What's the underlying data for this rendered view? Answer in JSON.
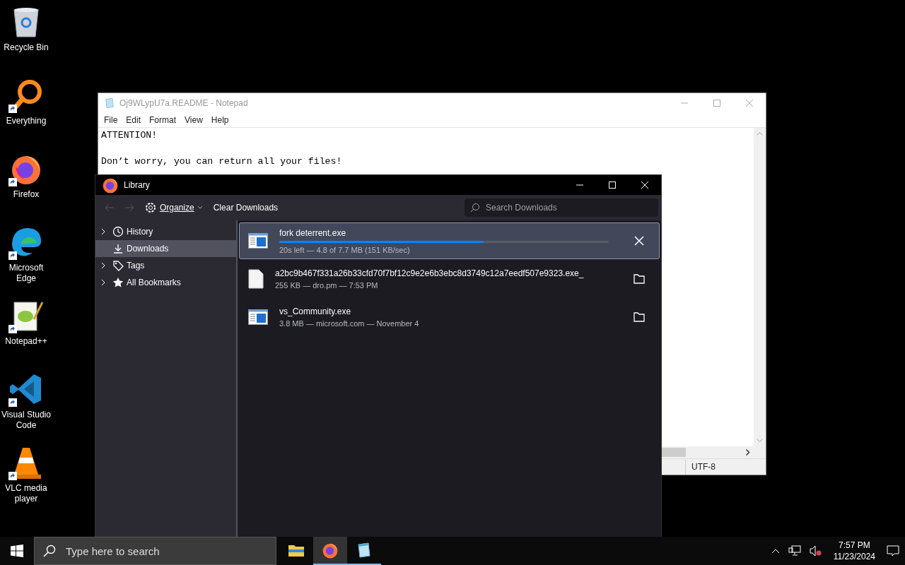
{
  "desktop_icons": [
    {
      "label": "Recycle Bin",
      "kind": "recycle",
      "shortcut": false
    },
    {
      "label": "Everything",
      "kind": "everything",
      "shortcut": true
    },
    {
      "label": "Firefox",
      "kind": "firefox",
      "shortcut": true
    },
    {
      "label": "Microsoft Edge",
      "kind": "edge",
      "shortcut": true
    },
    {
      "label": "Notepad++",
      "kind": "notepadpp",
      "shortcut": true
    },
    {
      "label": "Visual Studio Code",
      "kind": "vscode",
      "shortcut": true
    },
    {
      "label": "VLC media player",
      "kind": "vlc",
      "shortcut": true
    }
  ],
  "notepad": {
    "title": "Oj9WLypU7a.README - Notepad",
    "active": false,
    "menu": [
      "File",
      "Edit",
      "Format",
      "View",
      "Help"
    ],
    "lines": [
      {
        "text": "ATTENTION!",
        "blank_after": true
      },
      {
        "text": "Don’t worry, you can return all your files!",
        "blank_after": false
      }
    ],
    "encoding": "UTF-8"
  },
  "library": {
    "title": "Library",
    "active": true,
    "toolbar": {
      "organize": "Organize",
      "clear": "Clear Downloads",
      "search_placeholder": "Search Downloads"
    },
    "sidebar": [
      {
        "label": "History",
        "kind": "history",
        "expandable": true,
        "selected": false
      },
      {
        "label": "Downloads",
        "kind": "downloads",
        "expandable": false,
        "selected": true
      },
      {
        "label": "Tags",
        "kind": "tags",
        "expandable": true,
        "selected": false
      },
      {
        "label": "All Bookmarks",
        "kind": "bookmarks",
        "expandable": true,
        "selected": false
      }
    ],
    "downloads": [
      {
        "name": "fork deterrent.exe",
        "status": "20s left — 4.8 of 7.7 MB (151 KB/sec)",
        "kind": "exe",
        "level": 0.62,
        "selected": true
      },
      {
        "name": "a2bc9b467f331a26b33cfd70f7bf12c9e2e6b3ebc8d3749c12a7eedf507e9323.exe_",
        "status": "255 KB — dro.pm — 7:53 PM",
        "kind": "blank",
        "selected": false
      },
      {
        "name": "vs_Community.exe",
        "status": "3.8 MB — microsoft.com — November 4",
        "kind": "exe",
        "selected": false
      }
    ]
  },
  "taskbar": {
    "search_placeholder": "Type here to search",
    "apps": [
      {
        "kind": "explorer",
        "active": false,
        "running": false
      },
      {
        "kind": "firefox",
        "active": true,
        "running": true
      },
      {
        "kind": "notepad",
        "active": false,
        "running": true
      }
    ],
    "time": "7:57 PM",
    "date": "11/23/2024",
    "sound_muted": true
  }
}
